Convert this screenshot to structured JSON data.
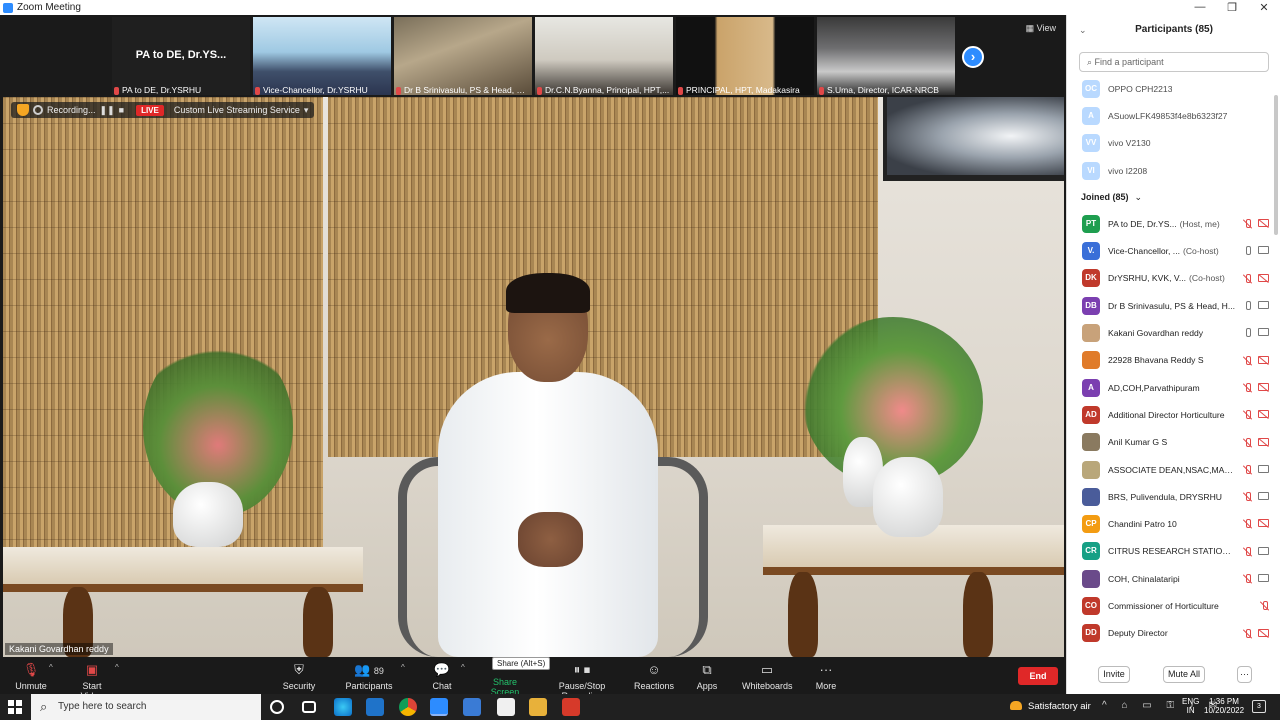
{
  "window": {
    "title": "Zoom Meeting",
    "controls": [
      "—",
      "❐",
      "✕"
    ]
  },
  "strip": {
    "tiles": [
      {
        "name": "PA to DE, Dr.YSRHU",
        "headline": "PA to DE, Dr.YS..."
      },
      {
        "name": "Vice-Chancellor, Dr.YSRHU"
      },
      {
        "name": "Dr B Srinivasulu, PS & Head, HRS..."
      },
      {
        "name": "Dr.C.N.Byanna, Principal, HPT,..."
      },
      {
        "name": "PRINCIPAL, HPT, Madakasira"
      },
      {
        "name": "S.Uma, Director, ICAR-NRCB"
      }
    ],
    "view_label": "View",
    "next_icon": "›"
  },
  "stage": {
    "recording_label": "Recording...",
    "pause_icon": "❚❚",
    "stop_icon": "■",
    "live_label": "LIVE",
    "stream_label": "Custom Live Streaming Service",
    "stream_caret": "▾",
    "speaker_name": "Kakani Govardhan reddy"
  },
  "toolbar": {
    "unmute": "Unmute",
    "start_video": "Start Video",
    "security": "Security",
    "participants": "Participants",
    "participants_count": "89",
    "chat": "Chat",
    "share_screen": "Share Screen",
    "share_tooltip": "Share (Alt+S)",
    "pause_stop": "Pause/Stop Recording",
    "reactions": "Reactions",
    "apps": "Apps",
    "whiteboards": "Whiteboards",
    "more": "More",
    "end": "End",
    "caret": "^"
  },
  "panel": {
    "title": "Participants (85)",
    "collapse_icon": "⌄",
    "search_placeholder": "Find a participant",
    "waiting": [
      {
        "initials": "OC",
        "name": "OPPO CPH2213",
        "color": "#2d8cff"
      },
      {
        "initials": "A",
        "name": "ASuowLFK49853f4e8b6323f27",
        "color": "#2d8cff"
      },
      {
        "initials": "VV",
        "name": "vivo V2130",
        "color": "#2d8cff"
      },
      {
        "initials": "VI",
        "name": "vivo I2208",
        "color": "#2d8cff"
      }
    ],
    "joined_label": "Joined (85)",
    "joined_caret": "⌄",
    "joined": [
      {
        "initials": "PT",
        "name": "PA to DE, Dr.YS...",
        "role": "(Host, me)",
        "color": "#1e9e4f",
        "mic": "off",
        "cam": "off"
      },
      {
        "initials": "V.",
        "name": "Vice-Chancellor, ...",
        "role": "(Co-host)",
        "color": "#3a6fd8",
        "mic": "on",
        "cam": "on"
      },
      {
        "initials": "DK",
        "name": "DrYSRHU, KVK, V...",
        "role": "(Co-host)",
        "color": "#c0392b",
        "mic": "off",
        "cam": "off"
      },
      {
        "initials": "DB",
        "name": "Dr B Srinivasulu, PS & Head, H...",
        "role": "",
        "color": "#7b3fb0",
        "mic": "on",
        "cam": "on"
      },
      {
        "initials": "",
        "name": "Kakani Govardhan reddy",
        "role": "",
        "color": "#c8a27a",
        "mic": "on",
        "cam": "on"
      },
      {
        "initials": "",
        "name": "22928 Bhavana Reddy S",
        "role": "",
        "color": "#e07b2a",
        "mic": "off",
        "cam": "off"
      },
      {
        "initials": "A",
        "name": "AD,COH,Parvathipuram",
        "role": "",
        "color": "#7b3fb0",
        "mic": "off",
        "cam": "off"
      },
      {
        "initials": "AD",
        "name": "Additional Director Horticulture",
        "role": "",
        "color": "#c0392b",
        "mic": "off",
        "cam": "off"
      },
      {
        "initials": "",
        "name": "Anil Kumar G S",
        "role": "",
        "color": "#8a7a60",
        "mic": "off",
        "cam": "off"
      },
      {
        "initials": "",
        "name": "ASSOCIATE DEAN,NSAC,MARK...",
        "role": "",
        "color": "#b9a77a",
        "mic": "off",
        "cam": "on"
      },
      {
        "initials": "",
        "name": "BRS, Pulivendula, DRYSRHU",
        "role": "",
        "color": "#4a5c9a",
        "mic": "off",
        "cam": "on"
      },
      {
        "initials": "CP",
        "name": "Chandini Patro 10",
        "role": "",
        "color": "#f39c12",
        "mic": "off",
        "cam": "off"
      },
      {
        "initials": "CR",
        "name": "CITRUS RESEARCH STATION-TI...",
        "role": "",
        "color": "#16a085",
        "mic": "off",
        "cam": "on"
      },
      {
        "initials": "",
        "name": "COH, Chinalataripi",
        "role": "",
        "color": "#6a4a8a",
        "mic": "off",
        "cam": "on"
      },
      {
        "initials": "CO",
        "name": "Commissioner of Horticulture",
        "role": "",
        "color": "#c0392b",
        "mic": "off",
        "cam": "none"
      },
      {
        "initials": "DD",
        "name": "Deputy Director",
        "role": "",
        "color": "#c0392b",
        "mic": "off",
        "cam": "off"
      }
    ],
    "invite": "Invite",
    "mute_all": "Mute All",
    "more": "···"
  },
  "taskbar": {
    "search_placeholder": "Type here to search",
    "weather": "Satisfactory air",
    "lang_top": "ENG",
    "lang_bottom": "IN",
    "time": "1:36 PM",
    "date": "10/20/2022",
    "notif_count": "3"
  }
}
